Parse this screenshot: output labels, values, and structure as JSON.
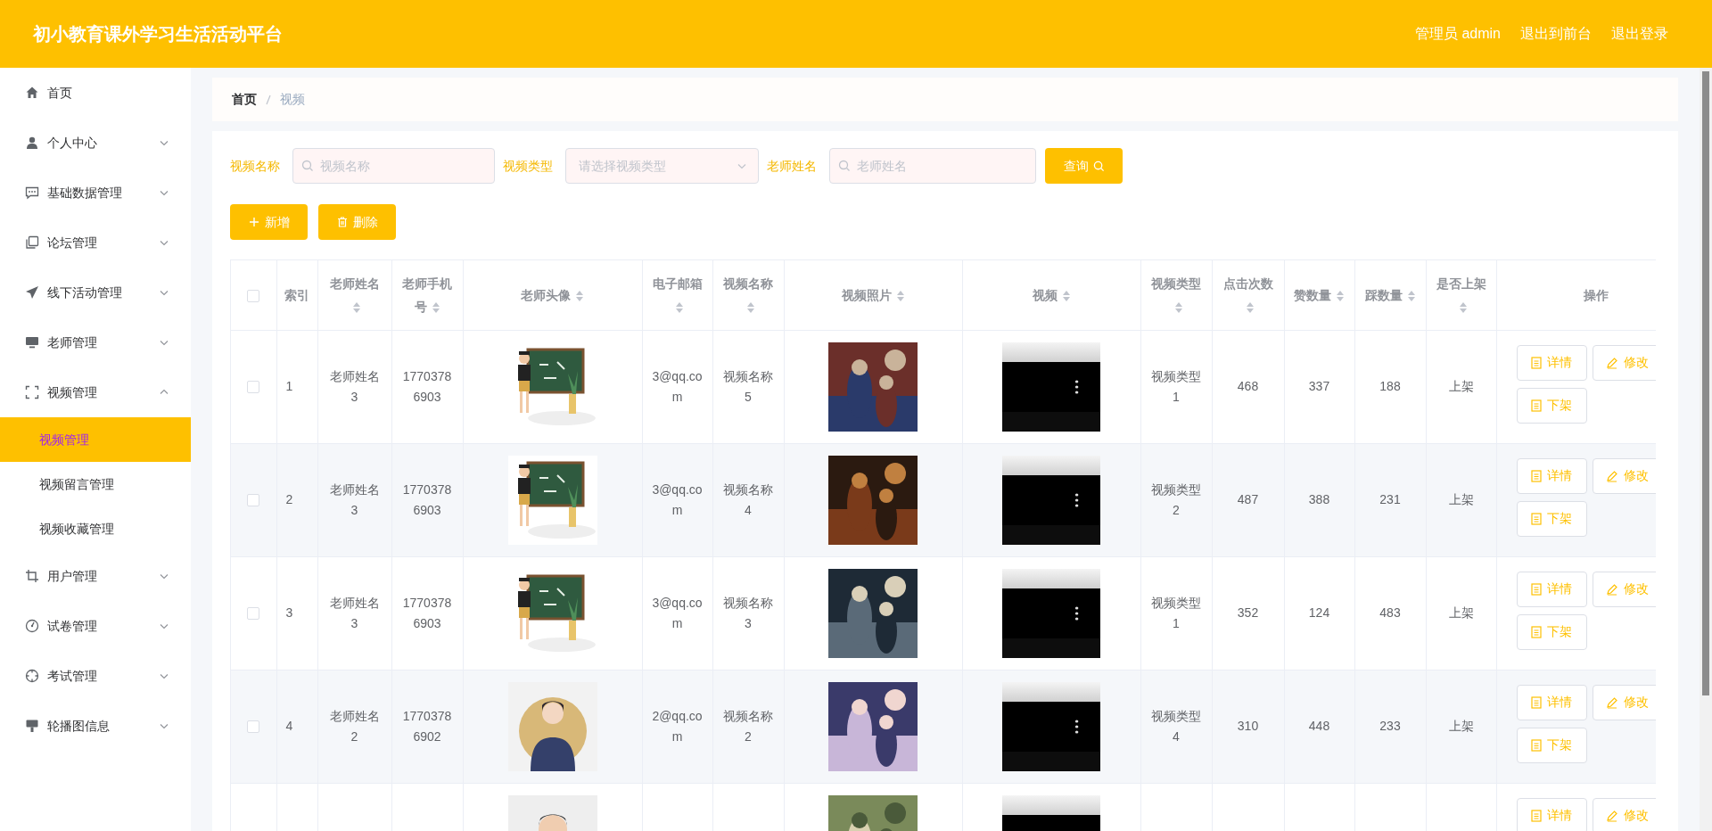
{
  "header": {
    "title": "初小教育课外学习生活活动平台",
    "links": [
      "管理员 admin",
      "退出到前台",
      "退出登录"
    ]
  },
  "sidebar": {
    "items": [
      {
        "label": "首页",
        "kind": "link"
      },
      {
        "label": "个人中心",
        "kind": "menu",
        "expanded": false
      },
      {
        "label": "基础数据管理",
        "kind": "menu",
        "expanded": false
      },
      {
        "label": "论坛管理",
        "kind": "menu",
        "expanded": false
      },
      {
        "label": "线下活动管理",
        "kind": "menu",
        "expanded": false
      },
      {
        "label": "老师管理",
        "kind": "menu",
        "expanded": false
      },
      {
        "label": "视频管理",
        "kind": "menu",
        "expanded": true,
        "children": [
          {
            "label": "视频管理",
            "selected": true
          },
          {
            "label": "视频留言管理",
            "selected": false
          },
          {
            "label": "视频收藏管理",
            "selected": false
          }
        ]
      },
      {
        "label": "用户管理",
        "kind": "menu",
        "expanded": false
      },
      {
        "label": "试卷管理",
        "kind": "menu",
        "expanded": false
      },
      {
        "label": "考试管理",
        "kind": "menu",
        "expanded": false
      },
      {
        "label": "轮播图信息",
        "kind": "menu",
        "expanded": false
      }
    ]
  },
  "breadcrumb": [
    {
      "label": "首页",
      "current": false
    },
    {
      "label": "视频",
      "current": true
    }
  ],
  "search": {
    "fields": [
      {
        "label": "视频名称",
        "placeholder": "视频名称",
        "kind": "text"
      },
      {
        "label": "视频类型",
        "placeholder": "请选择视频类型",
        "kind": "select"
      },
      {
        "label": "老师姓名",
        "placeholder": "老师姓名",
        "kind": "text"
      }
    ],
    "button": "查询"
  },
  "actions": [
    {
      "label": "新增",
      "kind": "add"
    },
    {
      "label": "删除",
      "kind": "delete"
    }
  ],
  "table": {
    "all_selected": false,
    "columns": [
      {
        "label": "索引",
        "kind": "text",
        "sortable": false
      },
      {
        "label": "老师姓名",
        "kind": "text",
        "sortable": true
      },
      {
        "label": "老师手机号",
        "kind": "text",
        "sortable": true
      },
      {
        "label": "老师头像",
        "kind": "picture",
        "sortable": true
      },
      {
        "label": "电子邮箱",
        "kind": "text",
        "sortable": true
      },
      {
        "label": "视频名称",
        "kind": "text",
        "sortable": true
      },
      {
        "label": "视频照片",
        "kind": "picture",
        "sortable": true
      },
      {
        "label": "视频",
        "kind": "video",
        "sortable": true
      },
      {
        "label": "视频类型",
        "kind": "text",
        "sortable": true
      },
      {
        "label": "点击次数",
        "kind": "text",
        "sortable": true
      },
      {
        "label": "赞数量",
        "kind": "text",
        "sortable": true
      },
      {
        "label": "踩数量",
        "kind": "text",
        "sortable": true
      },
      {
        "label": "是否上架",
        "kind": "text",
        "sortable": true
      },
      {
        "label": "操作",
        "kind": "actions",
        "sortable": false
      }
    ],
    "rows": [
      {
        "selected": false,
        "cells": [
          "1",
          "老师姓名3",
          "17703786903",
          {
            "kind": "picture"
          },
          "3@qq.com",
          "视频名称5",
          {
            "kind": "picture"
          },
          {
            "kind": "video"
          },
          "视频类型1",
          "468",
          "337",
          "188",
          "上架",
          {
            "actions": [
              {
                "label": "详情",
                "kind": "detail"
              },
              {
                "label": "修改",
                "kind": "edit"
              },
              {
                "label": "下架",
                "kind": "detail"
              }
            ]
          }
        ]
      },
      {
        "selected": false,
        "cells": [
          "2",
          "老师姓名3",
          "17703786903",
          {
            "kind": "picture"
          },
          "3@qq.com",
          "视频名称4",
          {
            "kind": "picture"
          },
          {
            "kind": "video"
          },
          "视频类型2",
          "487",
          "388",
          "231",
          "上架",
          {
            "actions": [
              {
                "label": "详情",
                "kind": "detail"
              },
              {
                "label": "修改",
                "kind": "edit"
              },
              {
                "label": "下架",
                "kind": "detail"
              }
            ]
          }
        ]
      },
      {
        "selected": false,
        "cells": [
          "3",
          "老师姓名3",
          "17703786903",
          {
            "kind": "picture"
          },
          "3@qq.com",
          "视频名称3",
          {
            "kind": "picture"
          },
          {
            "kind": "video"
          },
          "视频类型1",
          "352",
          "124",
          "483",
          "上架",
          {
            "actions": [
              {
                "label": "详情",
                "kind": "detail"
              },
              {
                "label": "修改",
                "kind": "edit"
              },
              {
                "label": "下架",
                "kind": "detail"
              }
            ]
          }
        ]
      },
      {
        "selected": false,
        "cells": [
          "4",
          "老师姓名2",
          "17703786902",
          {
            "kind": "picture"
          },
          "2@qq.com",
          "视频名称2",
          {
            "kind": "picture"
          },
          {
            "kind": "video"
          },
          "视频类型4",
          "310",
          "448",
          "233",
          "上架",
          {
            "actions": [
              {
                "label": "详情",
                "kind": "detail"
              },
              {
                "label": "修改",
                "kind": "edit"
              },
              {
                "label": "下架",
                "kind": "detail"
              }
            ]
          }
        ]
      },
      {
        "cells": [
          null,
          null,
          null,
          {
            "kind": "picture"
          },
          null,
          null,
          {
            "kind": "picture"
          },
          {
            "kind": "video"
          },
          null,
          null,
          null,
          null,
          null,
          {
            "actions": [
              {
                "label": "详情",
                "kind": "detail"
              },
              {
                "label": "修改",
                "kind": "edit"
              }
            ]
          }
        ]
      }
    ]
  }
}
